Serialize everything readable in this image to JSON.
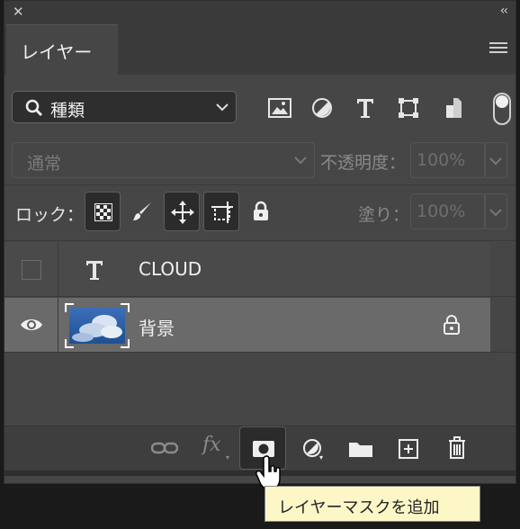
{
  "panel": {
    "tab_label": "レイヤー"
  },
  "filter": {
    "label": "種類"
  },
  "blend": {
    "mode": "通常",
    "opacity_label": "不透明度：",
    "opacity_value": "100%"
  },
  "lock": {
    "label": "ロック：",
    "fill_label": "塗り：",
    "fill_value": "100%"
  },
  "layers": [
    {
      "name": "CLOUD",
      "type": "text",
      "visible": false
    },
    {
      "name": "背景",
      "type": "image",
      "visible": true,
      "locked": true
    }
  ],
  "tooltip": {
    "text": "レイヤーマスクを追加"
  },
  "colors": {
    "panel_bg": "#464646",
    "selected_row": "#6a6a6a",
    "tooltip_bg": "#fdf7c8"
  }
}
